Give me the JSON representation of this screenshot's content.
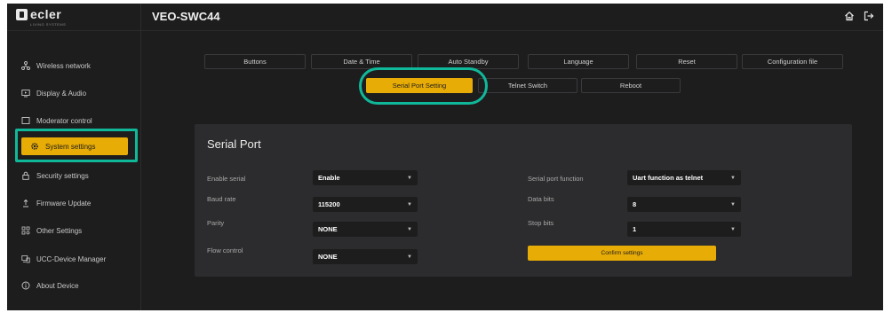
{
  "header": {
    "logo_text": "ecler",
    "logo_sub": "LIVING SYSTEMS",
    "device_name": "VEO-SWC44",
    "home_icon": "home-icon",
    "logout_icon": "logout-icon"
  },
  "sidebar": {
    "items": [
      {
        "label": "Wireless network",
        "icon": "network-icon"
      },
      {
        "label": "Display & Audio",
        "icon": "display-icon"
      },
      {
        "label": "Moderator control",
        "icon": "square-icon"
      },
      {
        "label": "System settings",
        "icon": "gear-icon",
        "active": true
      },
      {
        "label": "Security settings",
        "icon": "lock-icon"
      },
      {
        "label": "Firmware Update",
        "icon": "upload-icon"
      },
      {
        "label": "Other Settings",
        "icon": "grid-icon"
      },
      {
        "label": "UCC-Device Manager",
        "icon": "device-icon"
      },
      {
        "label": "About Device",
        "icon": "info-icon"
      }
    ]
  },
  "tabs": {
    "row1": [
      "Buttons",
      "Date & Time",
      "Auto Standby",
      "Language",
      "Reset",
      "Configuration file"
    ],
    "row2": [
      "Serial Port Setting",
      "Telnet Switch",
      "Reboot"
    ],
    "active": "Serial Port Setting"
  },
  "serial_port": {
    "title": "Serial Port",
    "enable_serial": {
      "label": "Enable serial",
      "value": "Enable"
    },
    "baud_rate": {
      "label": "Baud rate",
      "value": "115200"
    },
    "parity": {
      "label": "Parity",
      "value": "NONE"
    },
    "flow_control": {
      "label": "Flow control",
      "value": "NONE"
    },
    "serial_port_function": {
      "label": "Serial port function",
      "value": "Uart function as telnet"
    },
    "data_bits": {
      "label": "Data bits",
      "value": "8"
    },
    "stop_bits": {
      "label": "Stop bits",
      "value": "1"
    },
    "confirm_label": "Confirm settings"
  },
  "colors": {
    "accent": "#e8ac06",
    "highlight": "#10b89a",
    "background": "#1d1d1e",
    "panel": "#2c2c2e"
  }
}
